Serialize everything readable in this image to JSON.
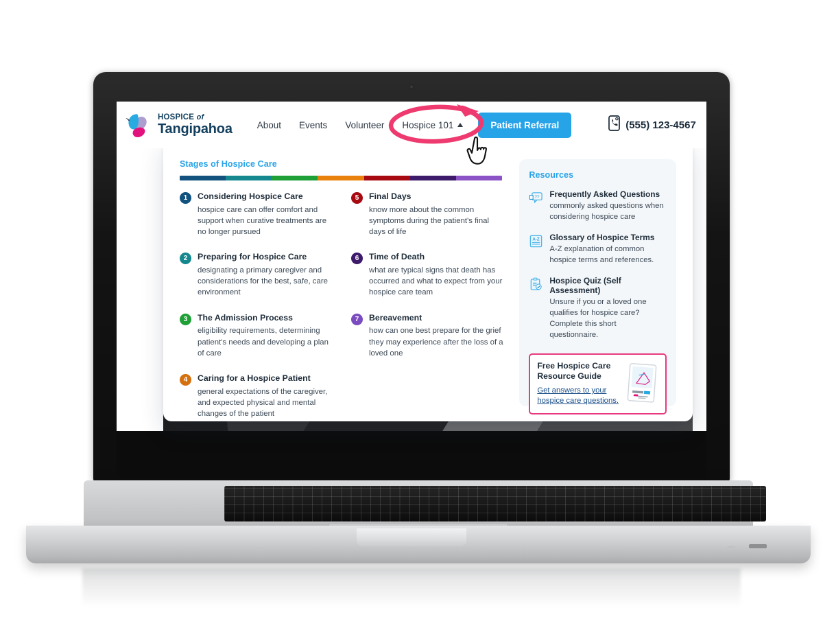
{
  "brand": {
    "line1_main": "HOSPICE",
    "line1_of": "of",
    "line2": "Tangipahoa",
    "logo_icon": "butterfly-logo-icon",
    "colors": {
      "cyan": "#29ABE2",
      "magenta": "#E2117E",
      "navy": "#14405F"
    }
  },
  "header": {
    "nav": [
      {
        "label": "About",
        "name": "about"
      },
      {
        "label": "Events",
        "name": "events"
      },
      {
        "label": "Volunteer",
        "name": "volunteer"
      }
    ],
    "dropdown_label": "Hospice 101",
    "dropdown_caret_icon": "chevron-up-icon",
    "cta_label": "Patient Referral",
    "cta_color": "#27A3E8",
    "phone_icon": "mobile-phone-icon",
    "phone_number": "(555) 123-4567"
  },
  "dropdown": {
    "stages": {
      "section_title": "Stages of Hospice Care",
      "bar_colors": [
        "#11527F",
        "#14888E",
        "#1FA037",
        "#E8820C",
        "#A80A12",
        "#3E1A6B",
        "#8C53C6"
      ],
      "column_left": [
        {
          "num": "1",
          "color": "#11527F",
          "title": "Considering Hospice Care",
          "desc": "hospice care can offer comfort and support when curative treatments are no longer pursued"
        },
        {
          "num": "2",
          "color": "#14888E",
          "title": "Preparing for Hospice Care",
          "desc": "designating a primary caregiver and considerations for the best, safe, care environment"
        },
        {
          "num": "3",
          "color": "#1FA037",
          "title": "The Admission Process",
          "desc": "eligibility requirements, determining patient's needs and developing a plan of care"
        },
        {
          "num": "4",
          "color": "#D4700E",
          "title": "Caring for a Hospice Patient",
          "desc": "general expectations of the caregiver, and expected physical and mental changes of the patient"
        }
      ],
      "column_right": [
        {
          "num": "5",
          "color": "#A80A12",
          "title": "Final Days",
          "desc": "know more about the common symptoms during the patient's final days of life"
        },
        {
          "num": "6",
          "color": "#3E1A6B",
          "title": "Time of Death",
          "desc": "what are typical signs that death has occurred and what to expect from your hospice care team"
        },
        {
          "num": "7",
          "color": "#7B4BC0",
          "title": "Bereavement",
          "desc": "how can one best prepare for the grief they may experience after the loss of a loved one"
        }
      ]
    },
    "resources": {
      "section_title": "Resources",
      "items": [
        {
          "icon": "chat-question-icon",
          "title": "Frequently Asked Questions",
          "desc": "commonly asked questions when considering hospice care"
        },
        {
          "icon": "a-z-book-icon",
          "title": "Glossary of Hospice Terms",
          "desc": "A-Z explanation of common hospice terms and references."
        },
        {
          "icon": "clipboard-check-icon",
          "title": "Hospice Quiz (Self Assessment)",
          "desc": "Unsure if you or a loved one qualifies for hospice care? Complete this short questionnaire."
        }
      ],
      "guide": {
        "title": "Free Hospice Care Resource Guide",
        "link_text": "Get answers to your hospice care questions.",
        "border_color": "#E8397F",
        "thumb_icon": "resource-guide-cover-icon"
      }
    }
  },
  "annotation": {
    "ellipse_icon": "pink-circle-annotation-icon",
    "ellipse_color": "#EE3A6E",
    "cursor_icon": "pointing-hand-cursor-icon"
  },
  "device": {
    "type": "laptop-mockup"
  }
}
